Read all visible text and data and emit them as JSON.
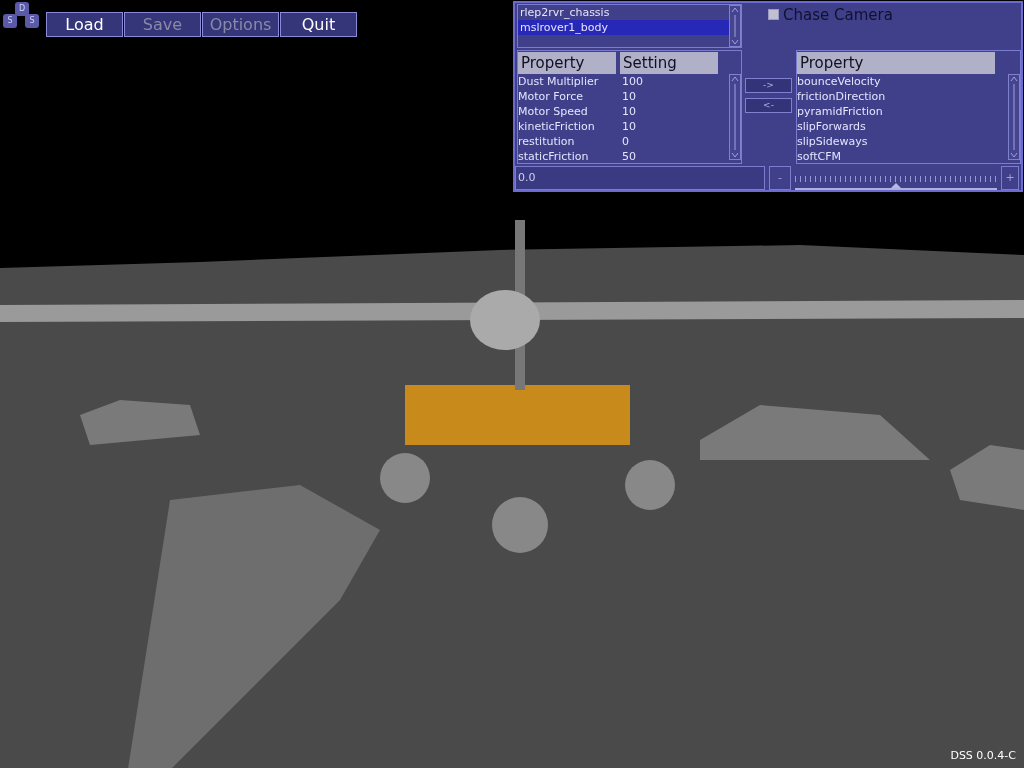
{
  "logo": {
    "letters": [
      "D",
      "S",
      "S"
    ]
  },
  "menu": [
    {
      "label": "Load",
      "disabled": false
    },
    {
      "label": "Save",
      "disabled": true
    },
    {
      "label": "Options",
      "disabled": true
    },
    {
      "label": "Quit",
      "disabled": false
    }
  ],
  "objects": [
    {
      "label": "rlep2rvr_chassis",
      "selected": false
    },
    {
      "label": "mslrover1_body",
      "selected": true
    }
  ],
  "chase_camera": {
    "label": "Chase Camera",
    "checked": false
  },
  "properties": {
    "columns": [
      "Property",
      "Setting"
    ],
    "rows": [
      [
        "Dust Multiplier",
        "100"
      ],
      [
        "Motor Force",
        "10"
      ],
      [
        "Motor Speed",
        "10"
      ],
      [
        "kineticFriction",
        "10"
      ],
      [
        "restitution",
        "0"
      ],
      [
        "staticFriction",
        "50"
      ]
    ]
  },
  "transfer_buttons": [
    "->",
    "<-"
  ],
  "available": {
    "column": "Property",
    "rows": [
      "bounceVelocity",
      "frictionDirection",
      "pyramidFriction",
      "slipForwards",
      "slipSideways",
      "softCFM"
    ]
  },
  "value_field": {
    "value": "0.0"
  },
  "slider": {
    "minus": "-",
    "plus": "+",
    "level": 0.5
  },
  "version": "DSS 0.0.4-C"
}
